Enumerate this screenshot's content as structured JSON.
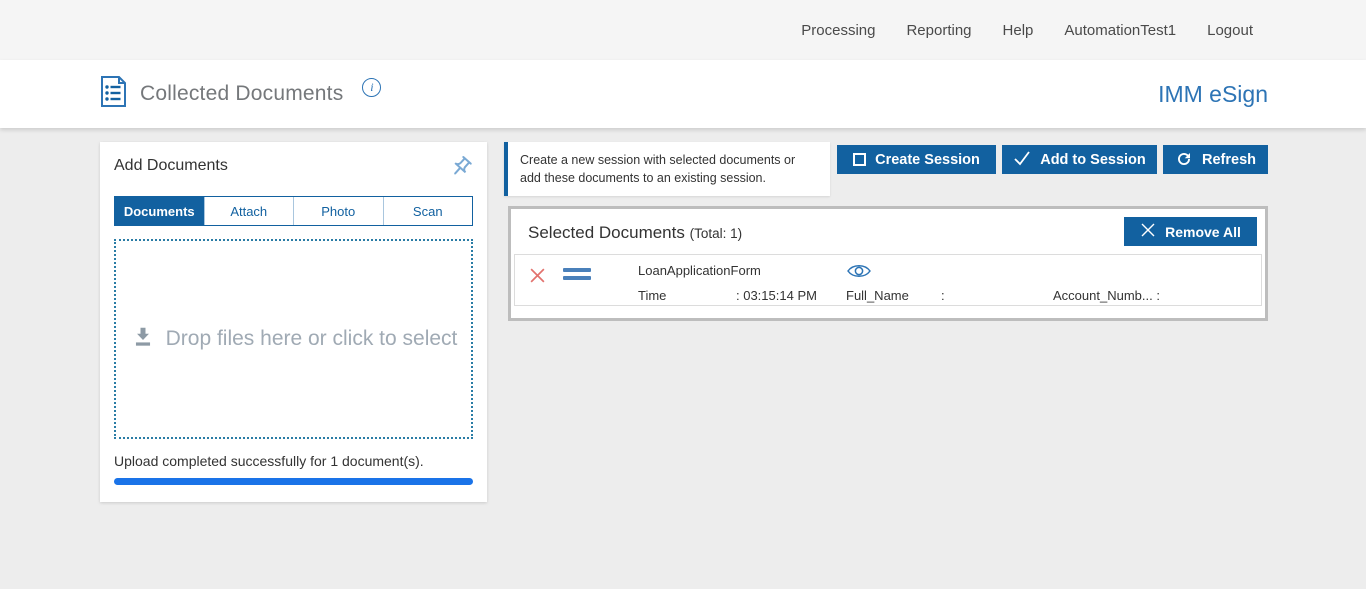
{
  "topnav": {
    "items": [
      {
        "label": "Processing"
      },
      {
        "label": "Reporting"
      },
      {
        "label": "Help"
      },
      {
        "label": "AutomationTest1"
      },
      {
        "label": "Logout"
      }
    ]
  },
  "header": {
    "title": "Collected Documents",
    "info_icon": "i",
    "brand": "IMM eSign"
  },
  "add_documents": {
    "title": "Add Documents",
    "tabs": [
      {
        "label": "Documents",
        "active": true
      },
      {
        "label": "Attach",
        "active": false
      },
      {
        "label": "Photo",
        "active": false
      },
      {
        "label": "Scan",
        "active": false
      }
    ],
    "dropzone_text": "Drop files here or click to select",
    "status_text": "Upload completed successfully for 1 document(s).",
    "progress_percent": 100
  },
  "session_hint": "Create a new session with selected documents or add these documents to an existing session.",
  "actions": {
    "create_session": "Create Session",
    "add_to_session": "Add to Session",
    "refresh": "Refresh"
  },
  "selected_documents": {
    "title": "Selected Documents",
    "total_label": "(Total: 1)",
    "remove_all": "Remove All",
    "documents": [
      {
        "name": "LoanApplicationForm",
        "time_label": "Time",
        "time_value": ": 03:15:14 PM",
        "full_name_label": "Full_Name",
        "full_name_value": ":",
        "account_label": "Account_Numb... :"
      }
    ]
  },
  "colors": {
    "accent_blue": "#1261A0",
    "progress_blue": "#1A73E8",
    "brand_blue": "#2D74B5",
    "dropzone_border": "#2A7CA5",
    "delete_red": "#E2726E"
  }
}
